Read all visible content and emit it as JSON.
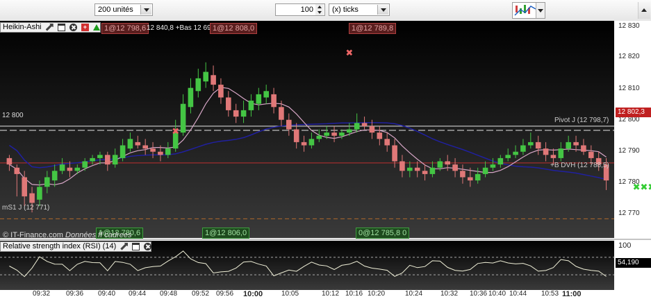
{
  "toolbar": {
    "units_combo": "200 unités",
    "ticks_value": "100",
    "ticks_combo": "(x) ticks"
  },
  "main_chart": {
    "header_title": "Heikin-Ashi",
    "header_orders": "1@12 798,6",
    "header_stats": "12 840,8 +Bas 12 69",
    "header_order2": "1@12 808,0",
    "order_top_right": "1@12 789,8",
    "orders_bottom": [
      "1@12 780,6",
      "1@12 806,0",
      "0@12 785,8 0"
    ],
    "level_12800_label": "12 800",
    "pivot_label": "Pivot J (12 798,7)",
    "bdvh_label": "+B DVH (12 788,5)",
    "ms1_label": "mS1 J (12 771)",
    "footer": "© IT-Finance.com",
    "footer_italic": "Données",
    "footer_tail": "ff cadrees",
    "current_price": "12 802,3",
    "y_ticks": [
      "12 830",
      "12 820",
      "12 810",
      "12 800",
      "12 790",
      "12 780",
      "12 770"
    ],
    "colors": {
      "up": "#44c544",
      "down": "#e07878",
      "ma_blue": "#2020a0",
      "ma_pink": "#d6a6c6",
      "support": "#c03030"
    }
  },
  "rsi_panel": {
    "title": "Relative strength index (RSI) (14)",
    "top_label": "100",
    "value": "54,190"
  },
  "x_axis": {
    "labels": [
      "09:32",
      "09:36",
      "09:40",
      "09:44",
      "09:48",
      "09:52",
      "09:56",
      "10:00",
      "10:05",
      "10:12",
      "10:16",
      "10:20",
      "10:24",
      "10:32",
      "10:36",
      "10:40",
      "10:44",
      "10:53",
      "11:00"
    ],
    "bold_labels": [
      "10:00",
      "11:00"
    ]
  },
  "chart_data": {
    "type": "candlestick",
    "title": "Heikin-Ashi",
    "ylim": [
      12765,
      12833
    ],
    "candles": [
      [
        12790,
        12788,
        12791,
        12786
      ],
      [
        12787,
        12785,
        12788,
        12778
      ],
      [
        12784,
        12778,
        12786,
        12775
      ],
      [
        12779,
        12776,
        12781,
        12773
      ],
      [
        12777,
        12781,
        12783,
        12775
      ],
      [
        12781,
        12784,
        12786,
        12779
      ],
      [
        12783,
        12786,
        12788,
        12781
      ],
      [
        12786,
        12788,
        12790,
        12785
      ],
      [
        12787,
        12786,
        12789,
        12784
      ],
      [
        12786,
        12787,
        12788,
        12785
      ],
      [
        12787,
        12789,
        12790,
        12786
      ],
      [
        12789,
        12790,
        12791,
        12788
      ],
      [
        12790,
        12791,
        12792,
        12788
      ],
      [
        12791,
        12788,
        12792,
        12786
      ],
      [
        12788,
        12791,
        12793,
        12787
      ],
      [
        12790,
        12794,
        12796,
        12789
      ],
      [
        12793,
        12796,
        12798,
        12792
      ],
      [
        12795,
        12794,
        12797,
        12793
      ],
      [
        12794,
        12793,
        12796,
        12791
      ],
      [
        12793,
        12792,
        12795,
        12790
      ],
      [
        12792,
        12791,
        12794,
        12789
      ],
      [
        12791,
        12793,
        12795,
        12790
      ],
      [
        12793,
        12798,
        12802,
        12792
      ],
      [
        12798,
        12807,
        12810,
        12797
      ],
      [
        12806,
        12812,
        12815,
        12804
      ],
      [
        12811,
        12815,
        12818,
        12809
      ],
      [
        12814,
        12817,
        12820,
        12812
      ],
      [
        12816,
        12813,
        12819,
        12811
      ],
      [
        12813,
        12809,
        12815,
        12807
      ],
      [
        12809,
        12805,
        12811,
        12803
      ],
      [
        12805,
        12803,
        12807,
        12801
      ],
      [
        12803,
        12805,
        12808,
        12801
      ],
      [
        12805,
        12808,
        12810,
        12803
      ],
      [
        12807,
        12810,
        12812,
        12805
      ],
      [
        12809,
        12811,
        12813,
        12807
      ],
      [
        12810,
        12806,
        12812,
        12804
      ],
      [
        12806,
        12802,
        12808,
        12800
      ],
      [
        12802,
        12799,
        12804,
        12797
      ],
      [
        12799,
        12795,
        12801,
        12793
      ],
      [
        12795,
        12794,
        12797,
        12792
      ],
      [
        12794,
        12796,
        12798,
        12793
      ],
      [
        12796,
        12797,
        12799,
        12795
      ],
      [
        12797,
        12798,
        12800,
        12796
      ],
      [
        12798,
        12797,
        12800,
        12795
      ],
      [
        12797,
        12798,
        12799,
        12796
      ],
      [
        12798,
        12799,
        12801,
        12797
      ],
      [
        12799,
        12801,
        12804,
        12798
      ],
      [
        12801,
        12800,
        12803,
        12799
      ],
      [
        12800,
        12798,
        12802,
        12796
      ],
      [
        12798,
        12796,
        12800,
        12794
      ],
      [
        12796,
        12794,
        12798,
        12792
      ],
      [
        12794,
        12789,
        12796,
        12787
      ],
      [
        12789,
        12786,
        12791,
        12784
      ],
      [
        12786,
        12787,
        12789,
        12784
      ],
      [
        12787,
        12786,
        12789,
        12784
      ],
      [
        12786,
        12785,
        12788,
        12783
      ],
      [
        12785,
        12787,
        12789,
        12784
      ],
      [
        12787,
        12789,
        12790,
        12786
      ],
      [
        12789,
        12788,
        12791,
        12786
      ],
      [
        12788,
        12786,
        12790,
        12784
      ],
      [
        12786,
        12784,
        12788,
        12782
      ],
      [
        12784,
        12783,
        12787,
        12781
      ],
      [
        12783,
        12785,
        12787,
        12782
      ],
      [
        12785,
        12787,
        12789,
        12784
      ],
      [
        12787,
        12788,
        12790,
        12786
      ],
      [
        12788,
        12790,
        12791,
        12787
      ],
      [
        12790,
        12791,
        12793,
        12789
      ],
      [
        12791,
        12792,
        12794,
        12790
      ],
      [
        12792,
        12794,
        12796,
        12791
      ],
      [
        12794,
        12795,
        12798,
        12793
      ],
      [
        12795,
        12793,
        12797,
        12791
      ],
      [
        12793,
        12791,
        12795,
        12789
      ],
      [
        12791,
        12790,
        12793,
        12788
      ],
      [
        12790,
        12793,
        12795,
        12789
      ],
      [
        12793,
        12795,
        12797,
        12792
      ],
      [
        12795,
        12794,
        12797,
        12792
      ],
      [
        12794,
        12792,
        12796,
        12791
      ],
      [
        12792,
        12790,
        12794,
        12788
      ],
      [
        12790,
        12788,
        12792,
        12786
      ],
      [
        12788,
        12783,
        12790,
        12780
      ]
    ]
  }
}
